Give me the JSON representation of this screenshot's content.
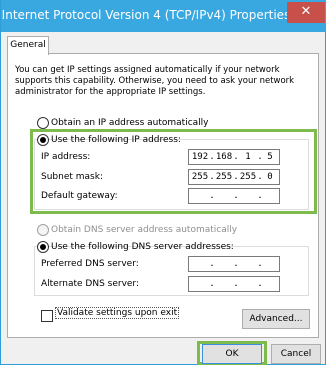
{
  "window": {
    "title": "Internet Protocol Version 4 (TCP/IPv4) Properties",
    "close_glyph": "✕"
  },
  "tabs": [
    {
      "label": "General"
    }
  ],
  "description": "You can get IP settings assigned automatically if your network supports this capability. Otherwise, you need to ask your network administrator for the appropriate IP settings.",
  "ip_section": {
    "auto_label": "Obtain an IP address automatically",
    "manual_label": "Use the following IP address:",
    "selected": "manual",
    "fields": [
      {
        "label": "IP address:",
        "octets": [
          "192",
          "168",
          "1",
          "5"
        ]
      },
      {
        "label": "Subnet mask:",
        "octets": [
          "255",
          "255",
          "255",
          "0"
        ]
      },
      {
        "label": "Default gateway:",
        "octets": [
          "",
          "",
          "",
          ""
        ]
      }
    ]
  },
  "dns_section": {
    "auto_label": "Obtain DNS server address automatically",
    "manual_label": "Use the following DNS server addresses:",
    "selected": "manual",
    "fields": [
      {
        "label": "Preferred DNS server:",
        "octets": [
          "",
          "",
          "",
          ""
        ]
      },
      {
        "label": "Alternate DNS server:",
        "octets": [
          "",
          "",
          "",
          ""
        ]
      }
    ]
  },
  "validate_checkbox": {
    "label": "Validate settings upon exit",
    "checked": false
  },
  "buttons": {
    "advanced": "Advanced...",
    "ok": "OK",
    "cancel": "Cancel"
  },
  "colors": {
    "titlebar": "#39a7e0",
    "highlight": "#7dbb4c",
    "close": "#c7504a"
  }
}
